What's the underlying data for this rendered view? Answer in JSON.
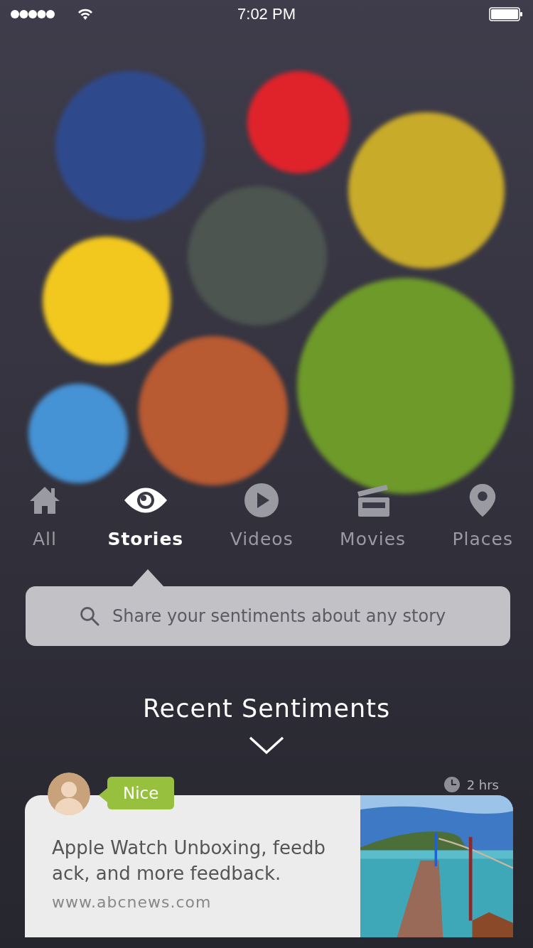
{
  "status_bar": {
    "time": "7:02 PM"
  },
  "bubbles": [
    {
      "color": "#2f4a8c"
    },
    {
      "color": "#e0232b"
    },
    {
      "color": "#c9ab2a"
    },
    {
      "color": "#4c5550"
    },
    {
      "color": "#f2c81f"
    },
    {
      "color": "#6e9a2a"
    },
    {
      "color": "#b85a32"
    },
    {
      "color": "#4592d4"
    }
  ],
  "tabs": [
    {
      "kind": "home",
      "label": "All",
      "selected": false
    },
    {
      "kind": "eye",
      "label": "Stories",
      "selected": true
    },
    {
      "kind": "play",
      "label": "Videos",
      "selected": false
    },
    {
      "kind": "clapper",
      "label": "Movies",
      "selected": false
    },
    {
      "kind": "pin",
      "label": "Places",
      "selected": false
    }
  ],
  "search": {
    "placeholder": "Share your sentiments about any story"
  },
  "section_title": "Recent Sentiments",
  "sentiment": {
    "tag": "Nice",
    "time": "2 hrs",
    "text": "Apple Watch Unboxing, feedb ack, and more feedback.",
    "source": "www.abcnews.com"
  }
}
